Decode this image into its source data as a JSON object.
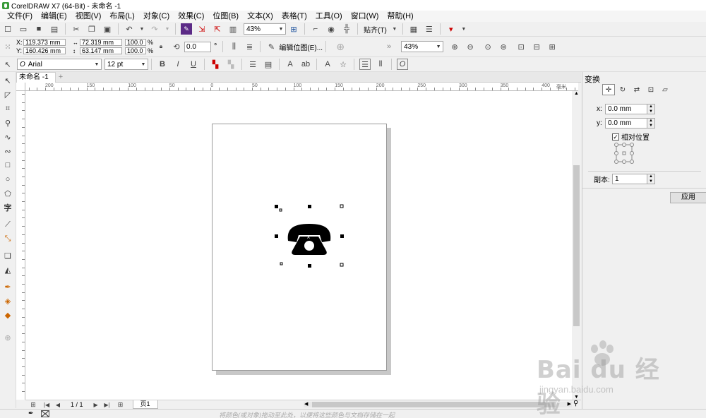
{
  "window": {
    "title": "CorelDRAW X7 (64-Bit) - 未命名 -1"
  },
  "menu": [
    "文件(F)",
    "编辑(E)",
    "视图(V)",
    "布局(L)",
    "对象(C)",
    "效果(C)",
    "位图(B)",
    "文本(X)",
    "表格(T)",
    "工具(O)",
    "窗口(W)",
    "帮助(H)"
  ],
  "toolbar": {
    "zoom": "43%",
    "snap_label": "贴齐(T)"
  },
  "propbar": {
    "x_label": "X:",
    "x": "119.373 mm",
    "y_label": "Y:",
    "y": "160.426 mm",
    "width": "72.319 mm",
    "height": "63.147 mm",
    "scale_w": "100.0",
    "scale_h": "100.0",
    "pct_w": "%",
    "pct_h": "%",
    "rotation": "0.0",
    "deg": "°",
    "edit_bitmap": "编辑位图(E)...",
    "zoom2": "43%"
  },
  "textbar": {
    "font": "Arial",
    "size": "12 pt"
  },
  "document": {
    "tab": "未命名 -1"
  },
  "ruler_labels": [
    "200",
    "150",
    "100",
    "50",
    "0",
    "50",
    "100",
    "150",
    "200",
    "250",
    "300",
    "350",
    "400"
  ],
  "ruler_unit": "毫米",
  "navigator": {
    "page": "1 / 1",
    "page_tab": "页1"
  },
  "status": {
    "hint": "将颜色(或对象)拖动至此处，以便将这些颜色与文档存储在一起"
  },
  "docker": {
    "title": "变换",
    "x_label": "x:",
    "x": "0.0 mm",
    "y_label": "y:",
    "y": "0.0 mm",
    "relative": "相对位置",
    "copies_label": "副本:",
    "copies": "1",
    "apply": "应用"
  },
  "watermark": {
    "text": "Bai du 经验",
    "sub": "jingyan.baidu.com"
  }
}
